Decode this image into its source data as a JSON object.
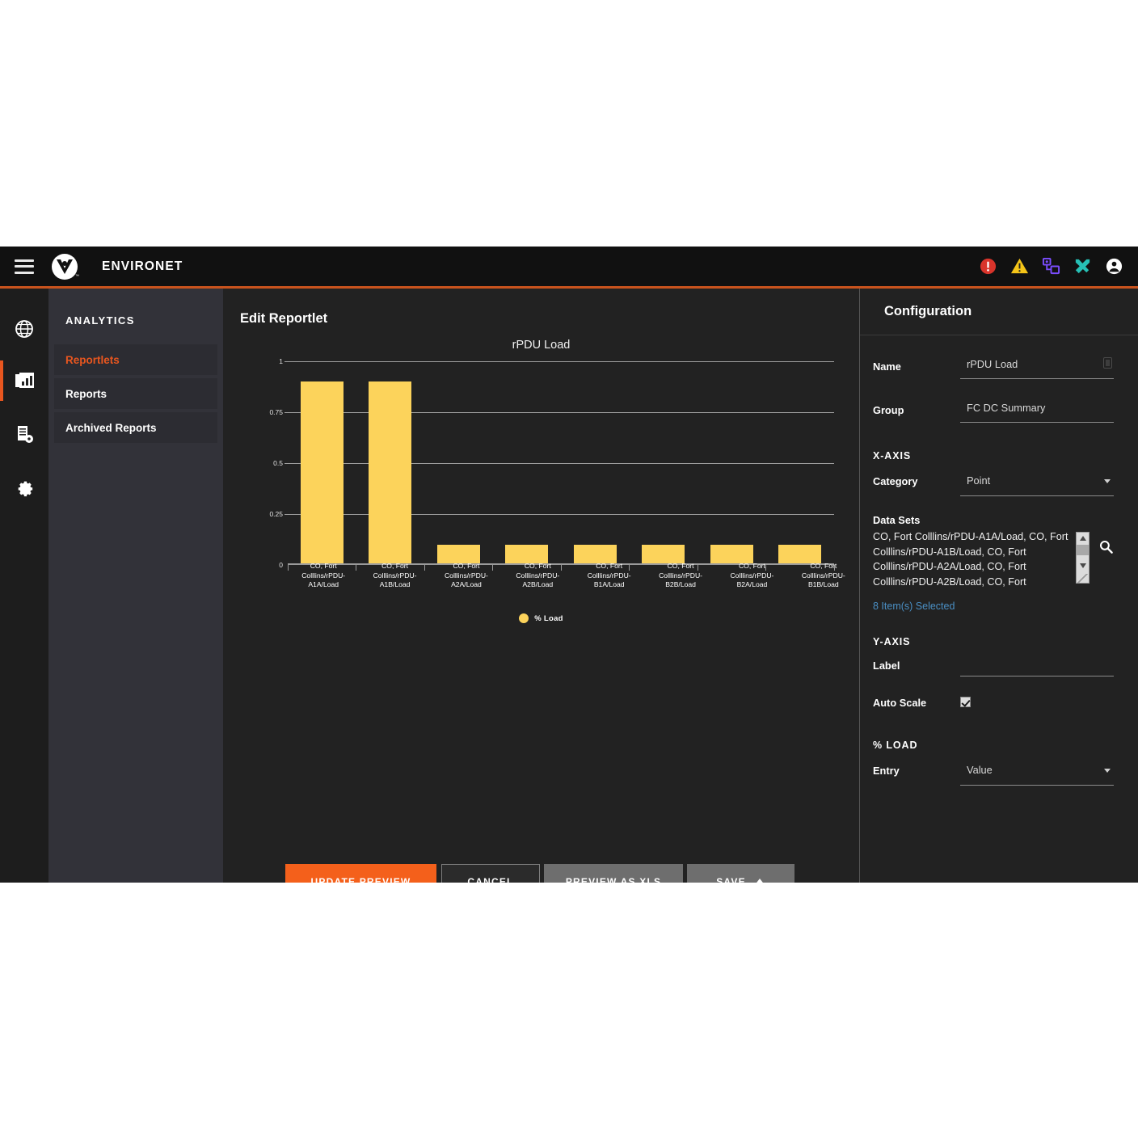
{
  "topbar": {
    "menu_icon": "hamburger-icon",
    "logo_icon": "environet-logo-icon",
    "brand": "ENVIRONET",
    "trademark": "™",
    "icons": [
      {
        "name": "alert-critical-icon",
        "color": "#d9342b"
      },
      {
        "name": "alert-warning-icon",
        "color": "#f5c518"
      },
      {
        "name": "network-devices-icon",
        "color": "#7c4dff"
      },
      {
        "name": "tools-icon",
        "color": "#26c0b5"
      },
      {
        "name": "user-account-icon",
        "color": "#ffffff"
      }
    ]
  },
  "rail": {
    "items": [
      {
        "name": "globe-icon",
        "active": false
      },
      {
        "name": "analytics-report-icon",
        "active": true
      },
      {
        "name": "server-settings-icon",
        "active": false
      },
      {
        "name": "gear-icon",
        "active": false
      }
    ]
  },
  "sidebar": {
    "title": "ANALYTICS",
    "items": [
      {
        "label": "Reportlets",
        "active": true
      },
      {
        "label": "Reports",
        "active": false
      },
      {
        "label": "Archived Reports",
        "active": false
      }
    ]
  },
  "main": {
    "title": "Edit Reportlet"
  },
  "chart_data": {
    "type": "bar",
    "title": "rPDU Load",
    "xlabel": "",
    "ylabel": "",
    "ylim": [
      0,
      1
    ],
    "yticks": [
      "0",
      "0.25",
      "0.5",
      "0.75",
      "1"
    ],
    "grid": true,
    "legend_position": "bottom",
    "legend": [
      "% Load"
    ],
    "bar_color": "#fcd35b",
    "categories": [
      "CO, Fort Colllins/rPDU-A1A/Load",
      "CO, Fort Colllins/rPDU-A1B/Load",
      "CO, Fort Colllins/rPDU-A2A/Load",
      "CO, Fort Colllins/rPDU-A2B/Load",
      "CO, Fort Colllins/rPDU-B1A/Load",
      "CO, Fort Colllins/rPDU-B2B/Load",
      "CO, Fort Colllins/rPDU-B2A/Load",
      "CO, Fort Colllins/rPDU-B1B/Load"
    ],
    "values": [
      0.9,
      0.9,
      0.1,
      0.1,
      0.1,
      0.1,
      0.1,
      0.1
    ],
    "series": [
      {
        "name": "% Load",
        "values": [
          0.9,
          0.9,
          0.1,
          0.1,
          0.1,
          0.1,
          0.1,
          0.1
        ]
      }
    ]
  },
  "actions": {
    "update_preview": "UPDATE PREVIEW",
    "cancel": "CANCEL",
    "preview_xls": "PREVIEW AS XLS",
    "save": "SAVE"
  },
  "config": {
    "title": "Configuration",
    "name_label": "Name",
    "name_value": "rPDU Load",
    "group_label": "Group",
    "group_value": "FC DC Summary",
    "xaxis_section": "X-AXIS",
    "category_label": "Category",
    "category_value": "Point",
    "datasets_label": "Data Sets",
    "datasets_value": "CO, Fort Colllins/rPDU-A1A/Load, CO, Fort Colllins/rPDU-A1B/Load, CO, Fort Colllins/rPDU-A2A/Load, CO, Fort Colllins/rPDU-A2B/Load, CO, Fort",
    "items_selected": "8 Item(s) Selected",
    "yaxis_section": "Y-AXIS",
    "ylabel_label": "Label",
    "ylabel_value": "",
    "autoscale_label": "Auto Scale",
    "autoscale_checked": true,
    "load_section": "% LOAD",
    "entry_label": "Entry",
    "entry_value": "Value"
  },
  "colors": {
    "accent_orange": "#e8561f",
    "button_orange": "#f4601b",
    "bar_yellow": "#fcd35b",
    "link_blue": "#4a8fc4",
    "app_bg": "#222222",
    "panel_bg": "#323239"
  }
}
